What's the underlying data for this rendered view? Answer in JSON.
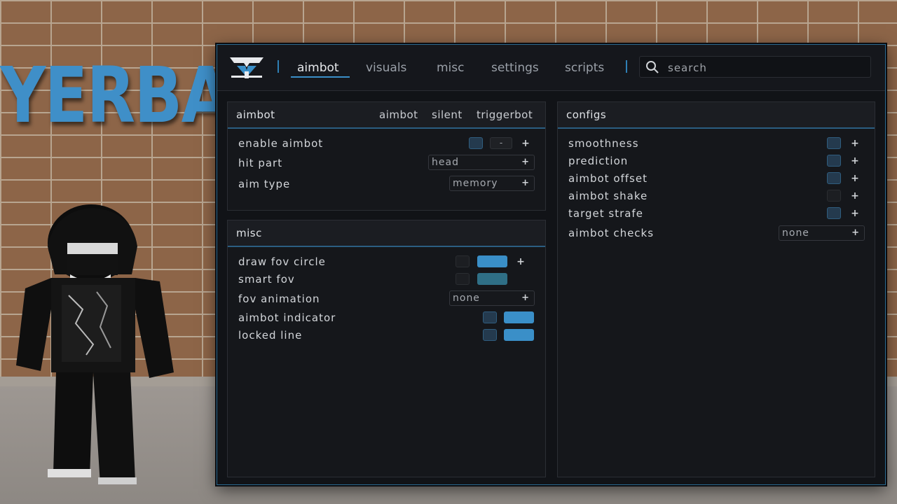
{
  "scene": {
    "sign_text": "YERBA"
  },
  "topbar": {
    "tabs": [
      {
        "label": "aimbot",
        "active": true
      },
      {
        "label": "visuals",
        "active": false
      },
      {
        "label": "misc",
        "active": false
      },
      {
        "label": "settings",
        "active": false
      },
      {
        "label": "scripts",
        "active": false
      }
    ],
    "search_placeholder": "search",
    "search_icon": "search-icon"
  },
  "aimbot_panel": {
    "title": "aimbot",
    "subtabs": [
      "aimbot",
      "silent",
      "triggerbot"
    ],
    "rows": [
      {
        "label": "enable aimbot",
        "checked": true,
        "keybind": "-"
      },
      {
        "label": "hit part",
        "value": "head"
      },
      {
        "label": "aim type",
        "value": "memory"
      }
    ]
  },
  "misc_panel": {
    "title": "misc",
    "rows": [
      {
        "label": "draw fov circle",
        "checked": false,
        "color": "#3a8fc8"
      },
      {
        "label": "smart fov",
        "checked": false,
        "color": "#2f6f86"
      },
      {
        "label": "fov animation",
        "value": "none"
      },
      {
        "label": "aimbot indicator",
        "checked": true,
        "color": "#3a8fc8"
      },
      {
        "label": "locked line",
        "checked": true,
        "color": "#3a8fc8"
      }
    ]
  },
  "configs_panel": {
    "title": "configs",
    "rows": [
      {
        "label": "smoothness",
        "checked": true
      },
      {
        "label": "prediction",
        "checked": true
      },
      {
        "label": "aimbot offset",
        "checked": true
      },
      {
        "label": "aimbot shake",
        "checked": false
      },
      {
        "label": "target strafe",
        "checked": true
      },
      {
        "label": "aimbot checks",
        "value": "none"
      }
    ]
  },
  "plus_symbol": "+",
  "colors": {
    "accent": "#3a8fc8",
    "window_bg": "#111317",
    "panel_bg": "#15171b",
    "checkbox_on": "#243a4e"
  }
}
